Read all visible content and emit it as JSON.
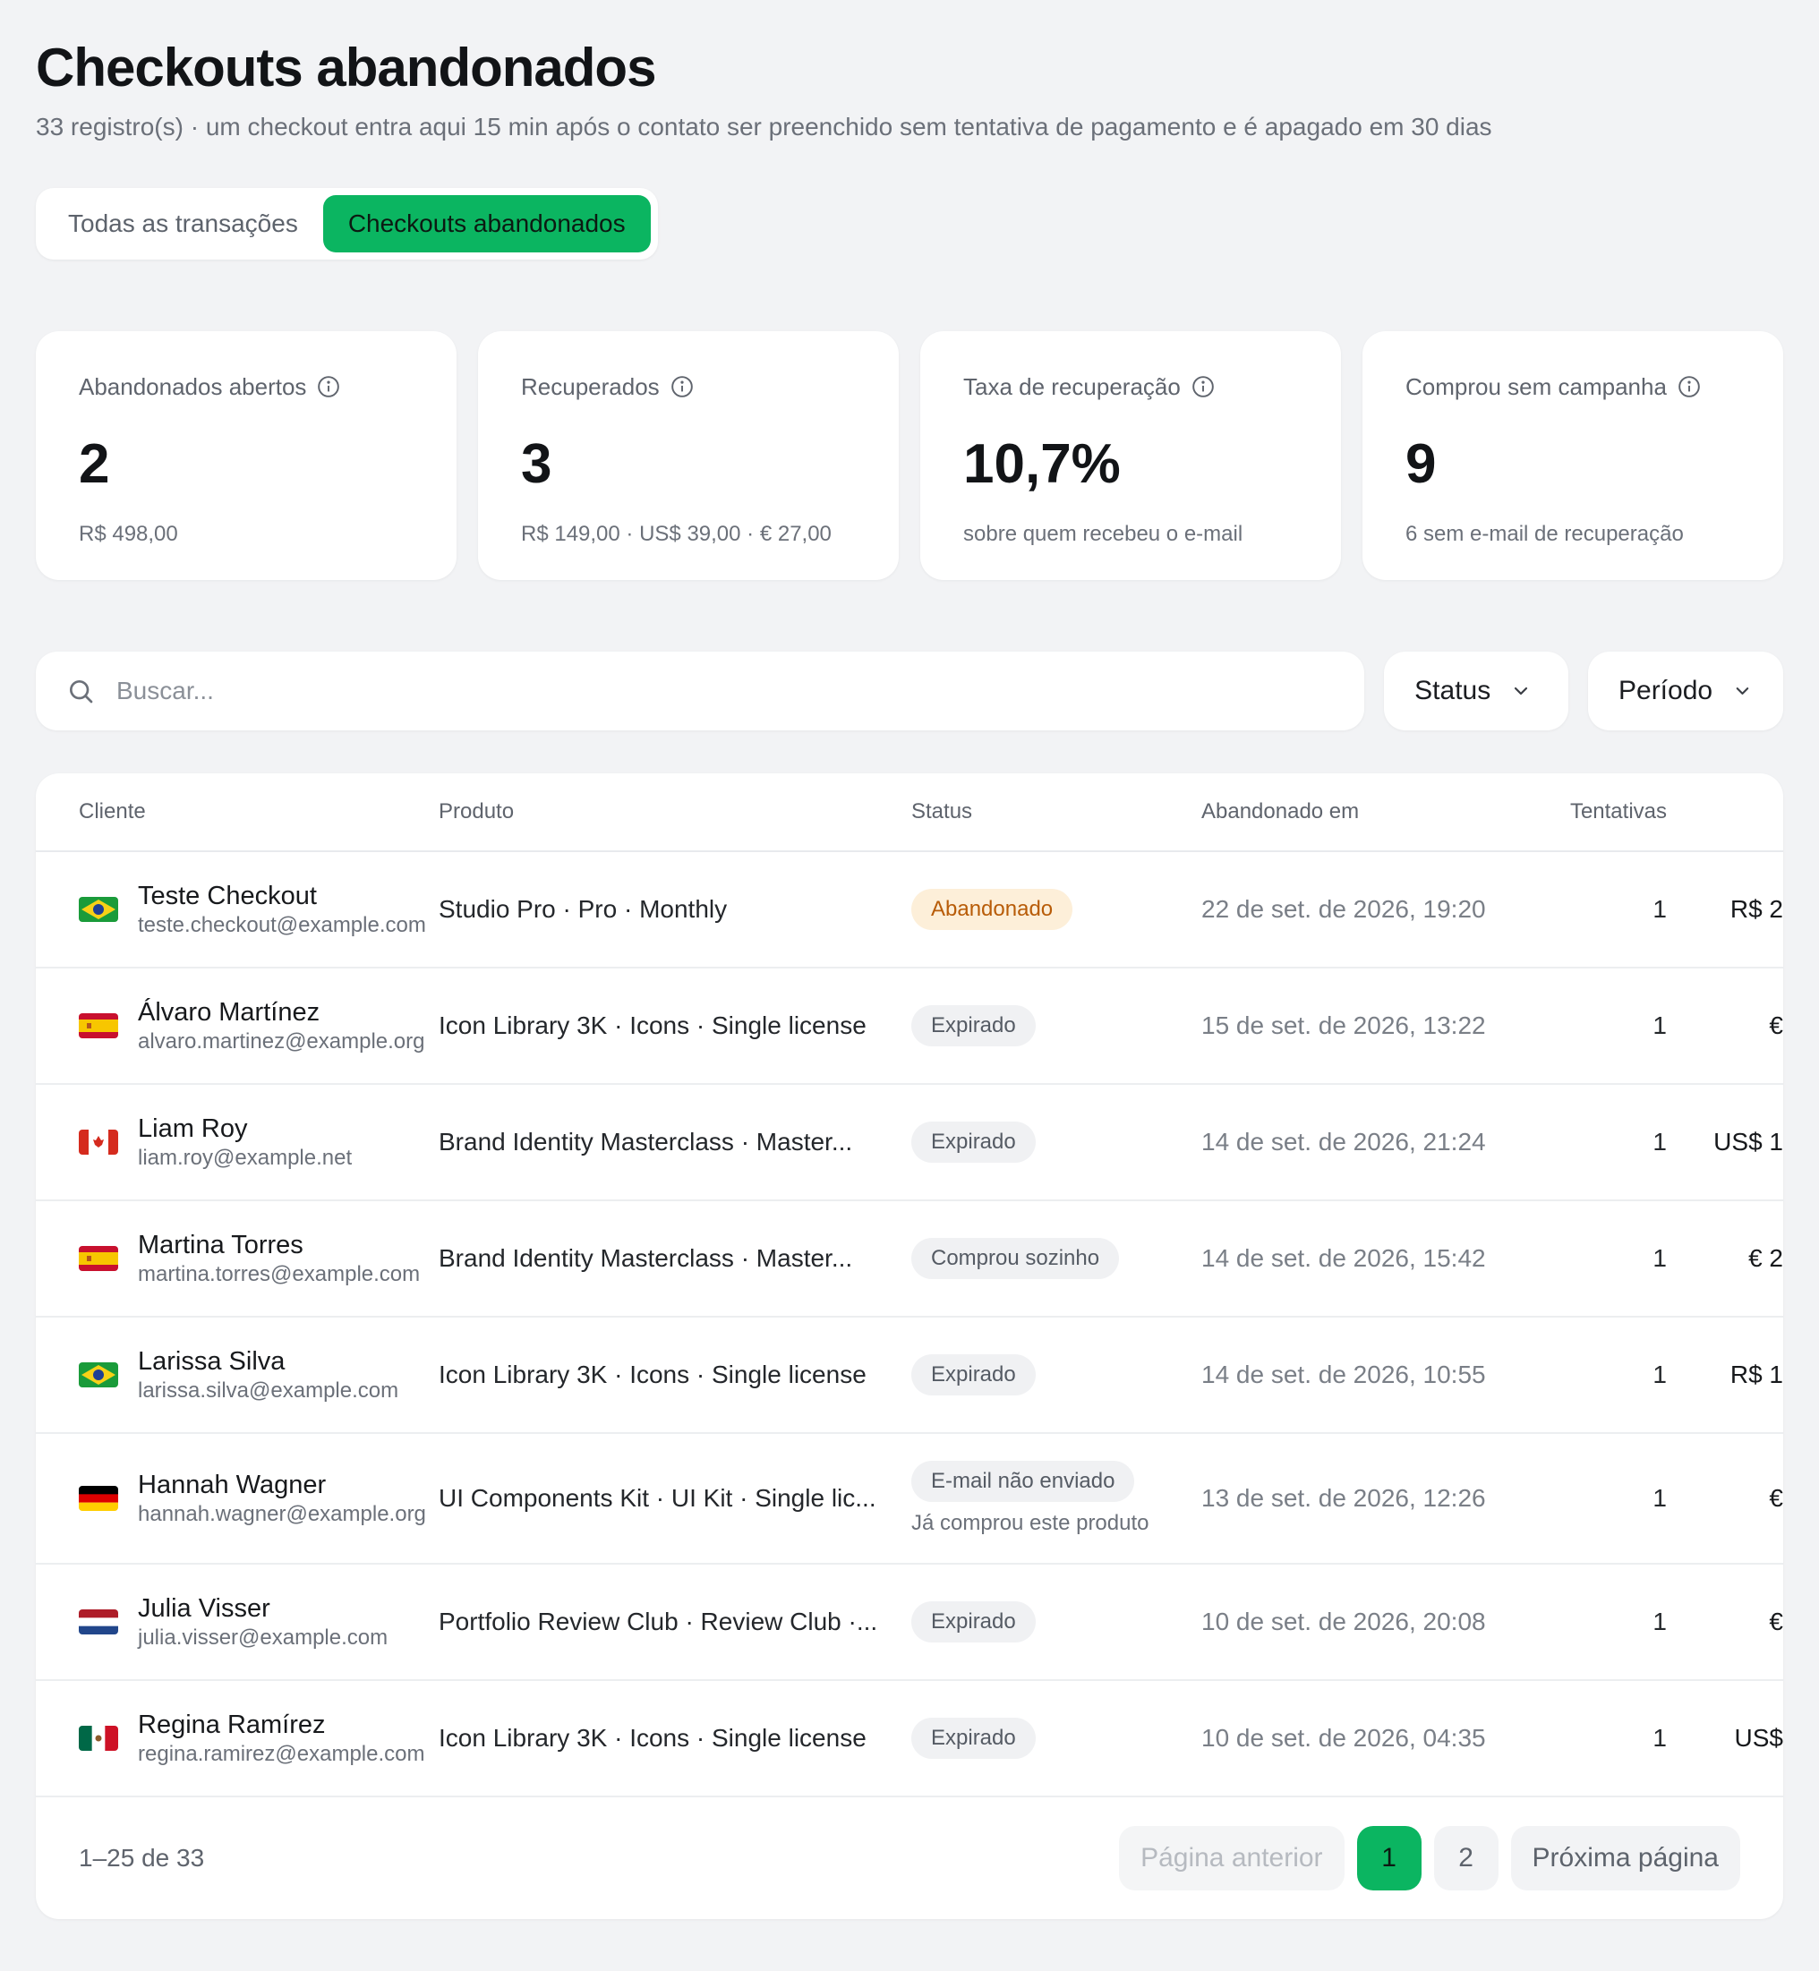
{
  "header": {
    "title": "Checkouts abandonados",
    "subtitle": "33 registro(s) · um checkout entra aqui 15 min após o contato ser preenchido sem tentativa de pagamento e é apagado em 30 dias"
  },
  "tabs": [
    {
      "label": "Todas as transações",
      "active": false
    },
    {
      "label": "Checkouts abandonados",
      "active": true
    }
  ],
  "stats": [
    {
      "label": "Abandonados abertos",
      "value": "2",
      "sub": "R$ 498,00"
    },
    {
      "label": "Recuperados",
      "value": "3",
      "sub": "R$ 149,00 · US$ 39,00 · € 27,00"
    },
    {
      "label": "Taxa de recuperação",
      "value": "10,7%",
      "sub": "sobre quem recebeu o e-mail"
    },
    {
      "label": "Comprou sem campanha",
      "value": "9",
      "sub": "6 sem e-mail de recuperação"
    }
  ],
  "filters": {
    "search_placeholder": "Buscar...",
    "status_label": "Status",
    "periodo_label": "Período"
  },
  "table": {
    "columns": {
      "cliente": "Cliente",
      "produto": "Produto",
      "status": "Status",
      "abandonado_em": "Abandonado em",
      "tentativas": "Tentativas"
    },
    "rows": [
      {
        "flag": "br",
        "name": "Teste Checkout",
        "email": "teste.checkout@example.com",
        "product": "Studio Pro · Pro · Monthly",
        "status": "Abandonado",
        "note": "",
        "date": "22 de set. de 2026, 19:20",
        "tentativas": "1",
        "valor": "R$ 2"
      },
      {
        "flag": "es",
        "name": "Álvaro Martínez",
        "email": "alvaro.martinez@example.org",
        "product": "Icon Library 3K · Icons · Single license",
        "status": "Expirado",
        "note": "",
        "date": "15 de set. de 2026, 13:22",
        "tentativas": "1",
        "valor": "€"
      },
      {
        "flag": "ca",
        "name": "Liam Roy",
        "email": "liam.roy@example.net",
        "product": "Brand Identity Masterclass · Master...",
        "status": "Expirado",
        "note": "",
        "date": "14 de set. de 2026, 21:24",
        "tentativas": "1",
        "valor": "US$ 1"
      },
      {
        "flag": "es",
        "name": "Martina Torres",
        "email": "martina.torres@example.com",
        "product": "Brand Identity Masterclass · Master...",
        "status": "Comprou sozinho",
        "note": "",
        "date": "14 de set. de 2026, 15:42",
        "tentativas": "1",
        "valor": "€ 2"
      },
      {
        "flag": "br",
        "name": "Larissa Silva",
        "email": "larissa.silva@example.com",
        "product": "Icon Library 3K · Icons · Single license",
        "status": "Expirado",
        "note": "",
        "date": "14 de set. de 2026, 10:55",
        "tentativas": "1",
        "valor": "R$ 1"
      },
      {
        "flag": "de",
        "name": "Hannah Wagner",
        "email": "hannah.wagner@example.org",
        "product": "UI Components Kit · UI Kit · Single lic...",
        "status": "E-mail não enviado",
        "note": "Já comprou este produto",
        "date": "13 de set. de 2026, 12:26",
        "tentativas": "1",
        "valor": "€"
      },
      {
        "flag": "nl",
        "name": "Julia Visser",
        "email": "julia.visser@example.com",
        "product": "Portfolio Review Club · Review Club ·...",
        "status": "Expirado",
        "note": "",
        "date": "10 de set. de 2026, 20:08",
        "tentativas": "1",
        "valor": "€"
      },
      {
        "flag": "mx",
        "name": "Regina Ramírez",
        "email": "regina.ramirez@example.com",
        "product": "Icon Library 3K · Icons · Single license",
        "status": "Expirado",
        "note": "",
        "date": "10 de set. de 2026, 04:35",
        "tentativas": "1",
        "valor": "US$"
      }
    ]
  },
  "pagination": {
    "range": "1–25 de 33",
    "prev_label": "Página anterior",
    "pages": [
      "1",
      "2"
    ],
    "current": "1",
    "next_label": "Próxima página"
  },
  "colors": {
    "accent": "#0bb561",
    "background": "#f2f3f5",
    "badge_abandonado_bg": "#fdefd9",
    "badge_abandonado_text": "#b85c08"
  }
}
